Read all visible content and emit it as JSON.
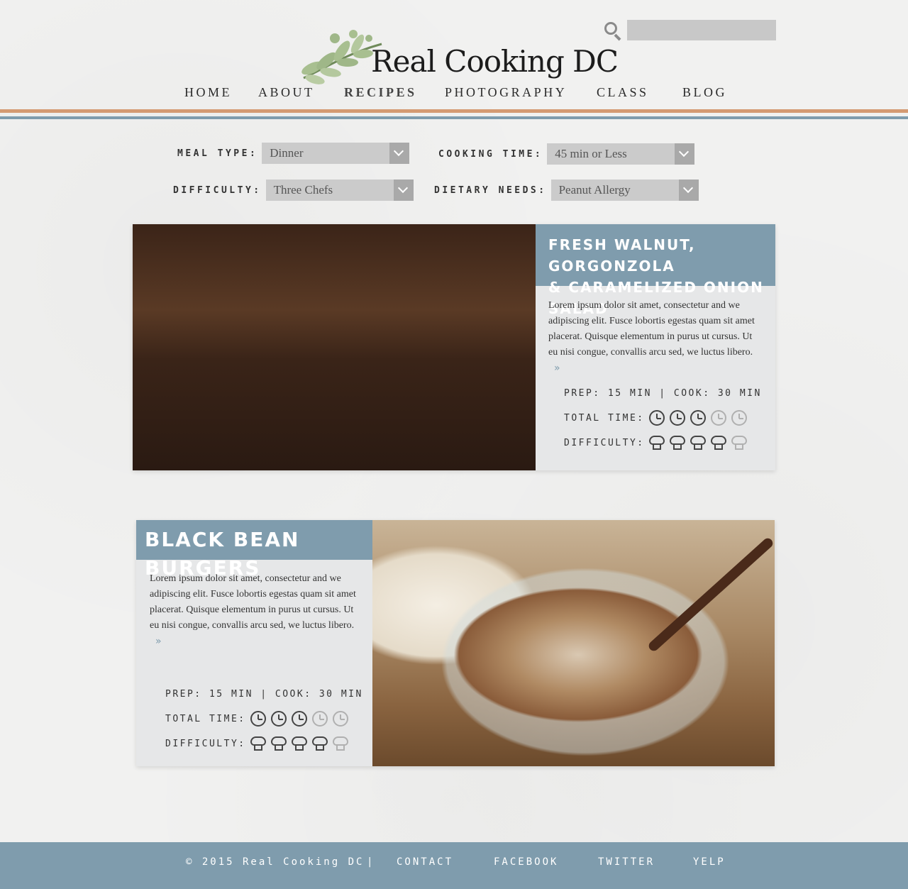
{
  "header": {
    "search_placeholder": "",
    "logo_text": "Real Cooking DC"
  },
  "nav": [
    {
      "label": "HOME"
    },
    {
      "label": "ABOUT"
    },
    {
      "label": "RECIPES"
    },
    {
      "label": "PHOTOGRAPHY"
    },
    {
      "label": "CLASS"
    },
    {
      "label": "BLOG"
    }
  ],
  "filters": {
    "meal_type": {
      "label": "MEAL TYPE:",
      "value": "Dinner"
    },
    "cooking_time": {
      "label": "COOKING TIME:",
      "value": "45 min or Less"
    },
    "difficulty": {
      "label": "DIFFICULTY:",
      "value": "Three Chefs"
    },
    "dietary_needs": {
      "label": "DIETARY NEEDS:",
      "value": "Peanut Allergy"
    }
  },
  "recipes": [
    {
      "title_line1": "FRESH WALNUT, GORGONZOLA",
      "title_line2": "& CARAMELIZED ONION SALAD",
      "description": "Lorem ipsum dolor sit amet, consectetur and we adipiscing elit. Fusce lobortis egestas quam sit amet placerat. Quisque elementum in purus ut cursus. Ut eu nisi congue, convallis arcu sed, we luctus libero.",
      "prep_cook": "PREP: 15 MIN  |  COOK: 30 MIN",
      "total_time_label": "TOTAL TIME:",
      "difficulty_label": "DIFFICULTY:",
      "total_time_rating": 3,
      "total_time_max": 5,
      "difficulty_rating": 4,
      "difficulty_max": 5
    },
    {
      "title": "BLACK BEAN BURGERS",
      "description": "Lorem ipsum dolor sit amet, consectetur and we adipiscing elit. Fusce lobortis egestas quam sit amet placerat. Quisque elementum in purus ut cursus. Ut eu nisi congue, convallis arcu sed, we luctus libero.",
      "prep_cook": "PREP: 15 MIN  |  COOK: 30 MIN",
      "total_time_label": "TOTAL TIME:",
      "difficulty_label": "DIFFICULTY:",
      "total_time_rating": 3,
      "total_time_max": 5,
      "difficulty_rating": 4,
      "difficulty_max": 5
    }
  ],
  "footer": {
    "copyright": "© 2015 Real Cooking DC",
    "separator": "|",
    "contact": "CONTACT",
    "facebook": "FACEBOOK",
    "twitter": "TWITTER",
    "yelp": "YELP"
  },
  "colors": {
    "accent_blue": "#7f9cad",
    "accent_orange": "#d49a72",
    "panel_gray": "#e6e7e8"
  }
}
